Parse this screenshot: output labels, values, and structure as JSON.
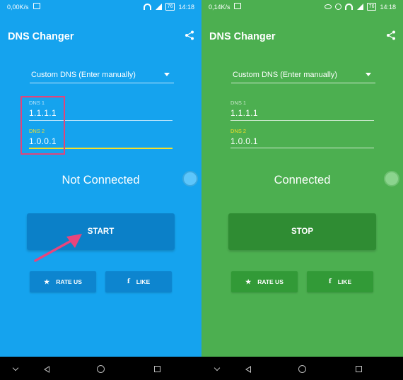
{
  "screens": [
    {
      "status_bar": {
        "speed": "0,00K/s",
        "battery": "76",
        "time": "14:18"
      },
      "app_title": "DNS Changer",
      "dropdown_value": "Custom DNS (Enter manually)",
      "dns1": {
        "label": "DNS 1",
        "value": "1.1.1.1"
      },
      "dns2": {
        "label": "DNS 2",
        "value": "1.0.0.1"
      },
      "status": "Not Connected",
      "main_button": "START",
      "rate_button": "RATE US",
      "like_button": "LIKE",
      "colors": {
        "background": "#15a3ee",
        "button": "#0b80c8"
      }
    },
    {
      "status_bar": {
        "speed": "0,14K/s",
        "battery": "76",
        "time": "14:18"
      },
      "app_title": "DNS Changer",
      "dropdown_value": "Custom DNS (Enter manually)",
      "dns1": {
        "label": "DNS 1",
        "value": "1.1.1.1"
      },
      "dns2": {
        "label": "DNS 2",
        "value": "1.0.0.1"
      },
      "status": "Connected",
      "main_button": "STOP",
      "rate_button": "RATE US",
      "like_button": "LIKE",
      "colors": {
        "background": "#4caf50",
        "button": "#2f8c33"
      }
    }
  ],
  "icons": [
    "share-icon",
    "star-icon",
    "facebook-icon",
    "chevron-down-icon",
    "back-icon",
    "home-icon",
    "recents-icon"
  ],
  "annotation_color": "#e0457b"
}
